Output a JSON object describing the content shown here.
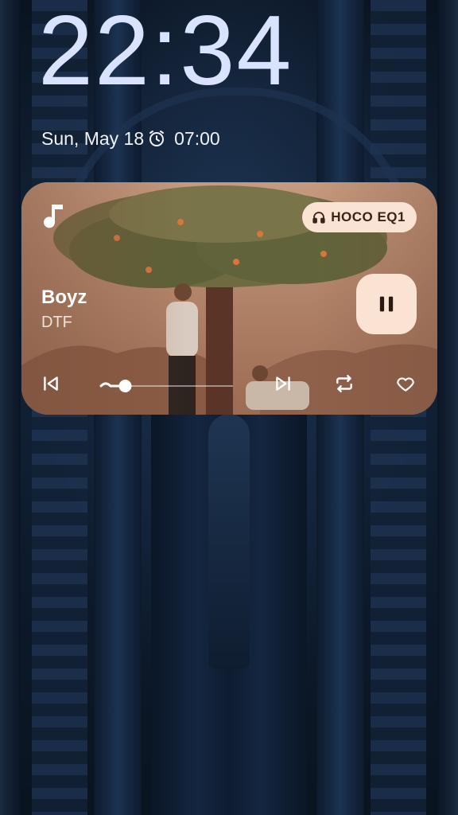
{
  "lockscreen": {
    "time": "22:34",
    "date": "Sun, May 18",
    "alarm_icon": "alarm-clock-icon",
    "alarm_time": "07:00"
  },
  "media": {
    "app_icon": "music-note-icon",
    "output_device": "HOCO EQ1",
    "output_device_icon": "headphones-icon",
    "track_title": "Boyz",
    "artist": "DTF",
    "playback_state": "playing",
    "progress": 0.12,
    "controls": {
      "previous_icon": "skip-previous-icon",
      "pause_icon": "pause-icon",
      "next_icon": "skip-next-icon",
      "repeat_icon": "repeat-icon",
      "favorite_icon": "heart-outline-icon"
    }
  },
  "colors": {
    "clock": "#d9e3ff",
    "chip_bg": "#fbe3d3",
    "chip_text": "#3a2418",
    "card_bg": "#a6785e"
  }
}
